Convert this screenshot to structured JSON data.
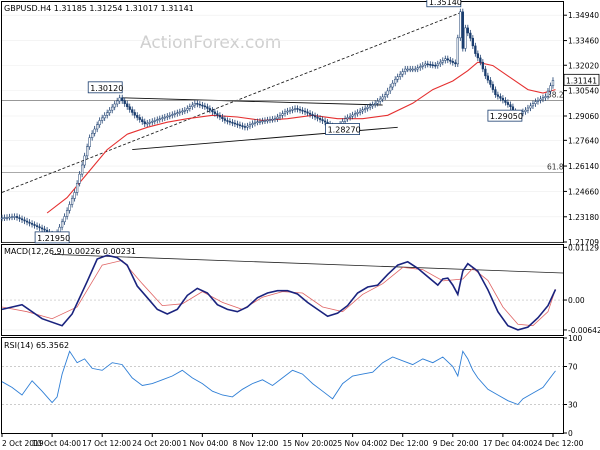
{
  "watermark": "ActionForex.com",
  "x_ticks": [
    "2 Oct 2019",
    "10 Oct 04:00",
    "17 Oct 12:00",
    "24 Oct 20:00",
    "1 Nov 04:00",
    "8 Nov 12:00",
    "15 Nov 20:00",
    "25 Nov 04:00",
    "2 Dec 12:00",
    "9 Dec 20:00",
    "17 Dec 04:00",
    "24 Dec 12:00"
  ],
  "chart_data": [
    {
      "type": "candlestick",
      "title": "GBPUSD.H4  1.31185 1.31254 1.31017 1.31141",
      "y_ticks": [
        "1.34940",
        "1.33460",
        "1.32020",
        "1.30540",
        "1.29060",
        "1.27640",
        "1.26140",
        "1.24660",
        "1.23180",
        "1.21709"
      ],
      "ylim": [
        1.21709,
        1.3571
      ],
      "last_price": "1.31141",
      "annotations": [
        {
          "label": "1.35140",
          "value": 1.3514
        },
        {
          "label": "1.30120",
          "value": 1.3012
        },
        {
          "label": "1.28270",
          "value": 1.2827
        },
        {
          "label": "1.29050",
          "value": 1.2905
        },
        {
          "label": "1.21950",
          "value": 1.2195
        }
      ],
      "fib_levels": [
        {
          "label": "38.2",
          "value": 1.2997
        },
        {
          "label": "61.8",
          "value": 1.2576
        }
      ],
      "close_path": [
        [
          0,
          1.231
        ],
        [
          6,
          1.232
        ],
        [
          12,
          1.228
        ],
        [
          18,
          1.224
        ],
        [
          22,
          1.2195
        ],
        [
          26,
          1.232
        ],
        [
          30,
          1.246
        ],
        [
          33,
          1.262
        ],
        [
          36,
          1.278
        ],
        [
          40,
          1.288
        ],
        [
          44,
          1.294
        ],
        [
          48,
          1.3012
        ],
        [
          51,
          1.296
        ],
        [
          54,
          1.291
        ],
        [
          58,
          1.286
        ],
        [
          62,
          1.288
        ],
        [
          68,
          1.291
        ],
        [
          74,
          1.294
        ],
        [
          78,
          1.298
        ],
        [
          82,
          1.296
        ],
        [
          86,
          1.292
        ],
        [
          90,
          1.288
        ],
        [
          94,
          1.286
        ],
        [
          98,
          1.284
        ],
        [
          102,
          1.287
        ],
        [
          106,
          1.288
        ],
        [
          110,
          1.289
        ],
        [
          114,
          1.293
        ],
        [
          118,
          1.295
        ],
        [
          122,
          1.293
        ],
        [
          126,
          1.29
        ],
        [
          130,
          1.287
        ],
        [
          134,
          1.2827
        ],
        [
          138,
          1.289
        ],
        [
          142,
          1.292
        ],
        [
          146,
          1.295
        ],
        [
          150,
          1.298
        ],
        [
          154,
          1.303
        ],
        [
          158,
          1.312
        ],
        [
          162,
          1.318
        ],
        [
          166,
          1.318
        ],
        [
          170,
          1.321
        ],
        [
          174,
          1.32
        ],
        [
          178,
          1.324
        ],
        [
          182,
          1.321
        ],
        [
          184,
          1.3514
        ],
        [
          185,
          1.33
        ],
        [
          186,
          1.342
        ],
        [
          188,
          1.336
        ],
        [
          190,
          1.327
        ],
        [
          192,
          1.322
        ],
        [
          194,
          1.314
        ],
        [
          196,
          1.309
        ],
        [
          198,
          1.303
        ],
        [
          200,
          1.301
        ],
        [
          204,
          1.296
        ],
        [
          206,
          1.2905
        ],
        [
          210,
          1.294
        ],
        [
          214,
          1.299
        ],
        [
          218,
          1.302
        ],
        [
          221,
          1.3114
        ]
      ],
      "ma_path": [
        [
          18,
          1.234
        ],
        [
          26,
          1.243
        ],
        [
          34,
          1.257
        ],
        [
          42,
          1.271
        ],
        [
          50,
          1.28
        ],
        [
          58,
          1.284
        ],
        [
          66,
          1.287
        ],
        [
          74,
          1.289
        ],
        [
          84,
          1.291
        ],
        [
          94,
          1.29
        ],
        [
          104,
          1.288
        ],
        [
          114,
          1.289
        ],
        [
          124,
          1.291
        ],
        [
          134,
          1.289
        ],
        [
          144,
          1.289
        ],
        [
          154,
          1.291
        ],
        [
          164,
          1.298
        ],
        [
          172,
          1.306
        ],
        [
          180,
          1.311
        ],
        [
          186,
          1.317
        ],
        [
          190,
          1.322
        ],
        [
          196,
          1.32
        ],
        [
          202,
          1.314
        ],
        [
          210,
          1.306
        ],
        [
          216,
          1.304
        ],
        [
          221,
          1.306
        ]
      ],
      "trendlines": [
        {
          "from": [
            0,
            1.246
          ],
          "to": [
            184,
            1.3514
          ]
        },
        {
          "from": [
            48,
            1.3012
          ],
          "to": [
            152,
            1.297
          ]
        },
        {
          "from": [
            52,
            1.271
          ],
          "to": [
            158,
            1.284
          ]
        },
        {
          "from": [
            0,
            1.2576
          ],
          "to": [
            224,
            1.2576
          ]
        },
        {
          "from": [
            0,
            1.2997
          ],
          "to": [
            224,
            1.2997
          ]
        }
      ]
    },
    {
      "type": "line",
      "title": "MACD(12,26,9) 0.00226 0.00231",
      "y_ticks": [
        "0.01129",
        "0.00",
        "-0.00642"
      ],
      "ylim": [
        -0.0075,
        0.0118
      ],
      "series": [
        {
          "values": [
            [
              0,
              -0.002
            ],
            [
              8,
              -0.001
            ],
            [
              16,
              -0.004
            ],
            [
              24,
              -0.0055
            ],
            [
              28,
              -0.003
            ],
            [
              34,
              0.004
            ],
            [
              38,
              0.0088
            ],
            [
              42,
              0.0096
            ],
            [
              46,
              0.0091
            ],
            [
              50,
              0.0075
            ],
            [
              54,
              0.003
            ],
            [
              58,
              0.0005
            ],
            [
              62,
              -0.002
            ],
            [
              66,
              -0.003
            ],
            [
              70,
              -0.002
            ],
            [
              74,
              0.001
            ],
            [
              78,
              0.0025
            ],
            [
              82,
              0.0015
            ],
            [
              86,
              -0.001
            ],
            [
              90,
              -0.002
            ],
            [
              94,
              -0.0025
            ],
            [
              98,
              -0.0015
            ],
            [
              102,
              0.0005
            ],
            [
              106,
              0.0015
            ],
            [
              110,
              0.002
            ],
            [
              114,
              0.002
            ],
            [
              118,
              0.0013
            ],
            [
              122,
              -0.0005
            ],
            [
              126,
              -0.002
            ],
            [
              130,
              -0.0035
            ],
            [
              134,
              -0.0028
            ],
            [
              138,
              -0.0012
            ],
            [
              142,
              0.0015
            ],
            [
              146,
              0.0028
            ],
            [
              150,
              0.0032
            ],
            [
              154,
              0.0055
            ],
            [
              158,
              0.0075
            ],
            [
              162,
              0.0082
            ],
            [
              166,
              0.0068
            ],
            [
              170,
              0.005
            ],
            [
              174,
              0.0032
            ],
            [
              176,
              0.0045
            ],
            [
              178,
              0.0047
            ],
            [
              180,
              0.0032
            ],
            [
              182,
              0.0012
            ],
            [
              184,
              0.0062
            ],
            [
              186,
              0.0078
            ],
            [
              190,
              0.0062
            ],
            [
              194,
              0.0022
            ],
            [
              198,
              -0.0025
            ],
            [
              202,
              -0.0055
            ],
            [
              206,
              -0.0064
            ],
            [
              210,
              -0.0058
            ],
            [
              214,
              -0.0038
            ],
            [
              218,
              -0.0012
            ],
            [
              221,
              0.00226
            ]
          ]
        },
        {
          "values": [
            [
              0,
              -0.0015
            ],
            [
              10,
              -0.0025
            ],
            [
              20,
              -0.004
            ],
            [
              30,
              -0.0015
            ],
            [
              40,
              0.0075
            ],
            [
              48,
              0.0085
            ],
            [
              56,
              0.0035
            ],
            [
              64,
              -0.0012
            ],
            [
              72,
              -0.0008
            ],
            [
              80,
              0.0018
            ],
            [
              88,
              -0.0005
            ],
            [
              96,
              -0.002
            ],
            [
              104,
              0.0006
            ],
            [
              112,
              0.0018
            ],
            [
              120,
              0.0015
            ],
            [
              128,
              -0.0015
            ],
            [
              136,
              -0.0025
            ],
            [
              144,
              0.0012
            ],
            [
              152,
              0.0035
            ],
            [
              160,
              0.007
            ],
            [
              168,
              0.0065
            ],
            [
              176,
              0.0041
            ],
            [
              184,
              0.0045
            ],
            [
              188,
              0.0068
            ],
            [
              194,
              0.0042
            ],
            [
              200,
              -0.0015
            ],
            [
              206,
              -0.0052
            ],
            [
              212,
              -0.0055
            ],
            [
              218,
              -0.0025
            ],
            [
              221,
              0.00231
            ]
          ]
        }
      ],
      "trendline": {
        "from": [
          20,
          0.0098
        ],
        "to": [
          224,
          0.0058
        ]
      }
    },
    {
      "type": "line",
      "title": "RSI(14) 65.3562",
      "y_ticks": [
        "100",
        "70",
        "30",
        "0"
      ],
      "ylim": [
        0,
        100
      ],
      "levels": [
        70,
        30
      ],
      "series": [
        {
          "values": [
            [
              0,
              54
            ],
            [
              4,
              48
            ],
            [
              8,
              40
            ],
            [
              12,
              55
            ],
            [
              16,
              44
            ],
            [
              20,
              32
            ],
            [
              22,
              38
            ],
            [
              24,
              62
            ],
            [
              27,
              86
            ],
            [
              30,
              74
            ],
            [
              33,
              78
            ],
            [
              36,
              68
            ],
            [
              40,
              66
            ],
            [
              44,
              74
            ],
            [
              48,
              72
            ],
            [
              52,
              58
            ],
            [
              56,
              50
            ],
            [
              60,
              52
            ],
            [
              64,
              56
            ],
            [
              68,
              60
            ],
            [
              72,
              66
            ],
            [
              76,
              58
            ],
            [
              80,
              52
            ],
            [
              84,
              44
            ],
            [
              88,
              40
            ],
            [
              92,
              38
            ],
            [
              96,
              46
            ],
            [
              100,
              52
            ],
            [
              104,
              56
            ],
            [
              108,
              50
            ],
            [
              112,
              58
            ],
            [
              116,
              66
            ],
            [
              120,
              62
            ],
            [
              124,
              52
            ],
            [
              128,
              44
            ],
            [
              132,
              36
            ],
            [
              136,
              52
            ],
            [
              140,
              60
            ],
            [
              144,
              62
            ],
            [
              148,
              64
            ],
            [
              152,
              74
            ],
            [
              156,
              80
            ],
            [
              160,
              76
            ],
            [
              164,
              72
            ],
            [
              168,
              78
            ],
            [
              172,
              74
            ],
            [
              176,
              80
            ],
            [
              180,
              70
            ],
            [
              182,
              60
            ],
            [
              184,
              86
            ],
            [
              186,
              78
            ],
            [
              188,
              66
            ],
            [
              190,
              58
            ],
            [
              194,
              46
            ],
            [
              198,
              40
            ],
            [
              202,
              34
            ],
            [
              206,
              30
            ],
            [
              208,
              36
            ],
            [
              212,
              42
            ],
            [
              216,
              48
            ],
            [
              220,
              62
            ],
            [
              221,
              65.36
            ]
          ]
        }
      ]
    }
  ]
}
